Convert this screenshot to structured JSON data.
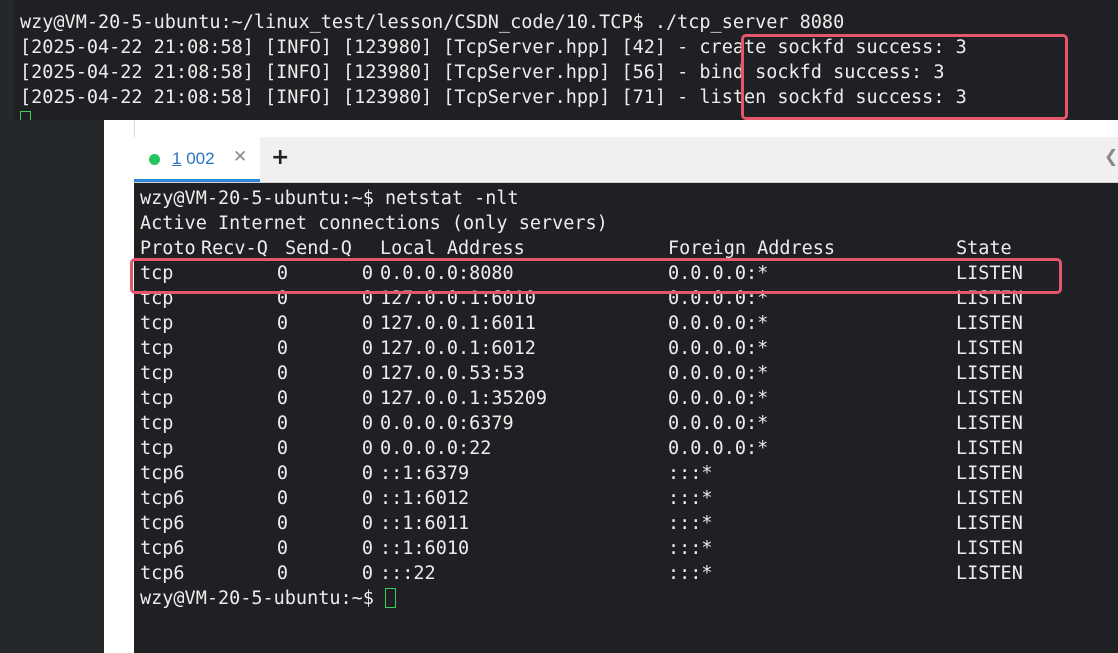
{
  "colors": {
    "terminal_bg": "#1f2023",
    "terminal_text": "#ececec",
    "cursor": "#3ccf5b",
    "highlight": "#e5566b",
    "tab_active_label": "#2a73c0",
    "tab_status_dot": "#22c55e"
  },
  "top_terminal": {
    "prompt_line": "wzy@VM-20-5-ubuntu:~/linux_test/lesson/CSDN_code/10.TCP$ ./tcp_server 8080",
    "log_lines": [
      {
        "prefix": "[2025-04-22 21:08:58] [INFO] [123980] [TcpServer.hpp] [42] - ",
        "message": "create sockfd success: 3"
      },
      {
        "prefix": "[2025-04-22 21:08:58] [INFO] [123980] [TcpServer.hpp] [56] - ",
        "message": "bind sockfd success: 3"
      },
      {
        "prefix": "[2025-04-22 21:08:58] [INFO] [123980] [TcpServer.hpp] [71] - ",
        "message": "listen sockfd success: 3"
      }
    ]
  },
  "tabs": {
    "active": {
      "hotkey": "1",
      "label": " 002",
      "close_icon": "close-icon"
    },
    "add_icon": "plus-icon",
    "scroll_icon": "chevron-left-icon"
  },
  "bottom_terminal": {
    "command_line": "wzy@VM-20-5-ubuntu:~$ netstat -nlt",
    "summary_line": "Active Internet connections (only servers)",
    "headers": {
      "proto": "Proto",
      "recvq": "Recv-Q",
      "sendq": "Send-Q",
      "local": "Local Address",
      "foreign": "Foreign Address",
      "state": "State"
    },
    "rows": [
      {
        "proto": "tcp",
        "recvq": "0",
        "sendq": "0",
        "local": "0.0.0.0:8080",
        "foreign": "0.0.0.0:*",
        "state": "LISTEN"
      },
      {
        "proto": "tcp",
        "recvq": "0",
        "sendq": "0",
        "local": "127.0.0.1:6010",
        "foreign": "0.0.0.0:*",
        "state": "LISTEN"
      },
      {
        "proto": "tcp",
        "recvq": "0",
        "sendq": "0",
        "local": "127.0.0.1:6011",
        "foreign": "0.0.0.0:*",
        "state": "LISTEN"
      },
      {
        "proto": "tcp",
        "recvq": "0",
        "sendq": "0",
        "local": "127.0.0.1:6012",
        "foreign": "0.0.0.0:*",
        "state": "LISTEN"
      },
      {
        "proto": "tcp",
        "recvq": "0",
        "sendq": "0",
        "local": "127.0.0.53:53",
        "foreign": "0.0.0.0:*",
        "state": "LISTEN"
      },
      {
        "proto": "tcp",
        "recvq": "0",
        "sendq": "0",
        "local": "127.0.0.1:35209",
        "foreign": "0.0.0.0:*",
        "state": "LISTEN"
      },
      {
        "proto": "tcp",
        "recvq": "0",
        "sendq": "0",
        "local": "0.0.0.0:6379",
        "foreign": "0.0.0.0:*",
        "state": "LISTEN"
      },
      {
        "proto": "tcp",
        "recvq": "0",
        "sendq": "0",
        "local": "0.0.0.0:22",
        "foreign": "0.0.0.0:*",
        "state": "LISTEN"
      },
      {
        "proto": "tcp6",
        "recvq": "0",
        "sendq": "0",
        "local": "::1:6379",
        "foreign": ":::*",
        "state": "LISTEN"
      },
      {
        "proto": "tcp6",
        "recvq": "0",
        "sendq": "0",
        "local": "::1:6012",
        "foreign": ":::*",
        "state": "LISTEN"
      },
      {
        "proto": "tcp6",
        "recvq": "0",
        "sendq": "0",
        "local": "::1:6011",
        "foreign": ":::*",
        "state": "LISTEN"
      },
      {
        "proto": "tcp6",
        "recvq": "0",
        "sendq": "0",
        "local": "::1:6010",
        "foreign": ":::*",
        "state": "LISTEN"
      },
      {
        "proto": "tcp6",
        "recvq": "0",
        "sendq": "0",
        "local": ":::22",
        "foreign": ":::*",
        "state": "LISTEN"
      }
    ],
    "final_prompt": "wzy@VM-20-5-ubuntu:~$"
  }
}
